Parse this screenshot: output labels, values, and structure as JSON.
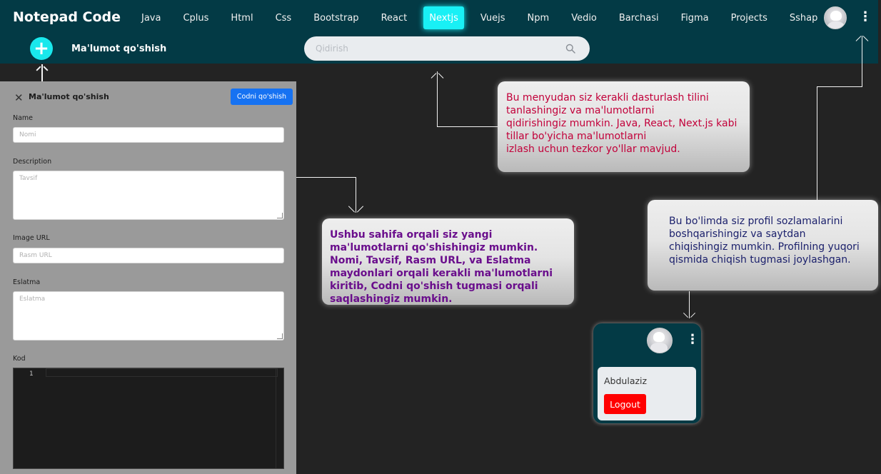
{
  "app": {
    "title": "Notepad Code"
  },
  "nav": {
    "items": [
      {
        "label": "Java",
        "active": false
      },
      {
        "label": "Cplus",
        "active": false
      },
      {
        "label": "Html",
        "active": false
      },
      {
        "label": "Css",
        "active": false
      },
      {
        "label": "Bootstrap",
        "active": false
      },
      {
        "label": "React",
        "active": false
      },
      {
        "label": "Nextjs",
        "active": true
      },
      {
        "label": "Vuejs",
        "active": false
      },
      {
        "label": "Npm",
        "active": false
      },
      {
        "label": "Vedio",
        "active": false
      },
      {
        "label": "Barchasi",
        "active": false
      },
      {
        "label": "Figma",
        "active": false
      },
      {
        "label": "Projects",
        "active": false
      },
      {
        "label": "Sshap",
        "active": false
      }
    ],
    "more_icon": "⋮"
  },
  "add": {
    "icon": "+",
    "label": "Ma'lumot qo'shish"
  },
  "search": {
    "placeholder": "Qidirish",
    "icon": "search-icon"
  },
  "form": {
    "close_icon": "✕",
    "title": "Ma'lumot qo'shish",
    "submit_label": "Codni qo'shish",
    "fields": {
      "name": {
        "label": "Name",
        "placeholder": "Nomi"
      },
      "description": {
        "label": "Description",
        "placeholder": "Tavsif"
      },
      "image": {
        "label": "Image URL",
        "placeholder": "Rasm URL"
      },
      "note": {
        "label": "Eslatma",
        "placeholder": "Eslatma"
      },
      "code": {
        "label": "Kod",
        "line_number": "1"
      }
    }
  },
  "tips": {
    "menu": "Bu menyudan siz kerakli dasturlash tilini\ntanlashingiz va ma'lumotlarni\n qidirishingiz mumkin. Java, React, Next.js kabi\ntillar bo'yicha ma'lumotlarni\nizlash uchun tezkor yo'llar mavjud.",
    "add": "Ushbu sahifa orqali siz yangi ma'lumotlarni qo'shishingiz mumkin. Nomi, Tavsif, Rasm URL, va Eslatma maydonlari orqali kerakli ma'lumotlarni kiritib, Codni qo'shish tugmasi orqali saqlashingiz mumkin.",
    "profile": "Bu bo'limda siz profil sozlamalarini boshqarishingiz va saytdan chiqishingiz mumkin. Profilning yuqori qismida chiqish tugmasi joylashgan."
  },
  "profile_card": {
    "username": "Abdulaziz",
    "logout_label": "Logout",
    "more_icon": "⋮"
  },
  "colors": {
    "topbar": "#033a45",
    "accent": "#19f0f5",
    "primary_button": "#1672f2",
    "logout": "#ff0000",
    "menu_tip_text": "#c2003a",
    "add_tip_text": "#6a0e8c",
    "profile_tip_text": "#1a1f6b"
  }
}
